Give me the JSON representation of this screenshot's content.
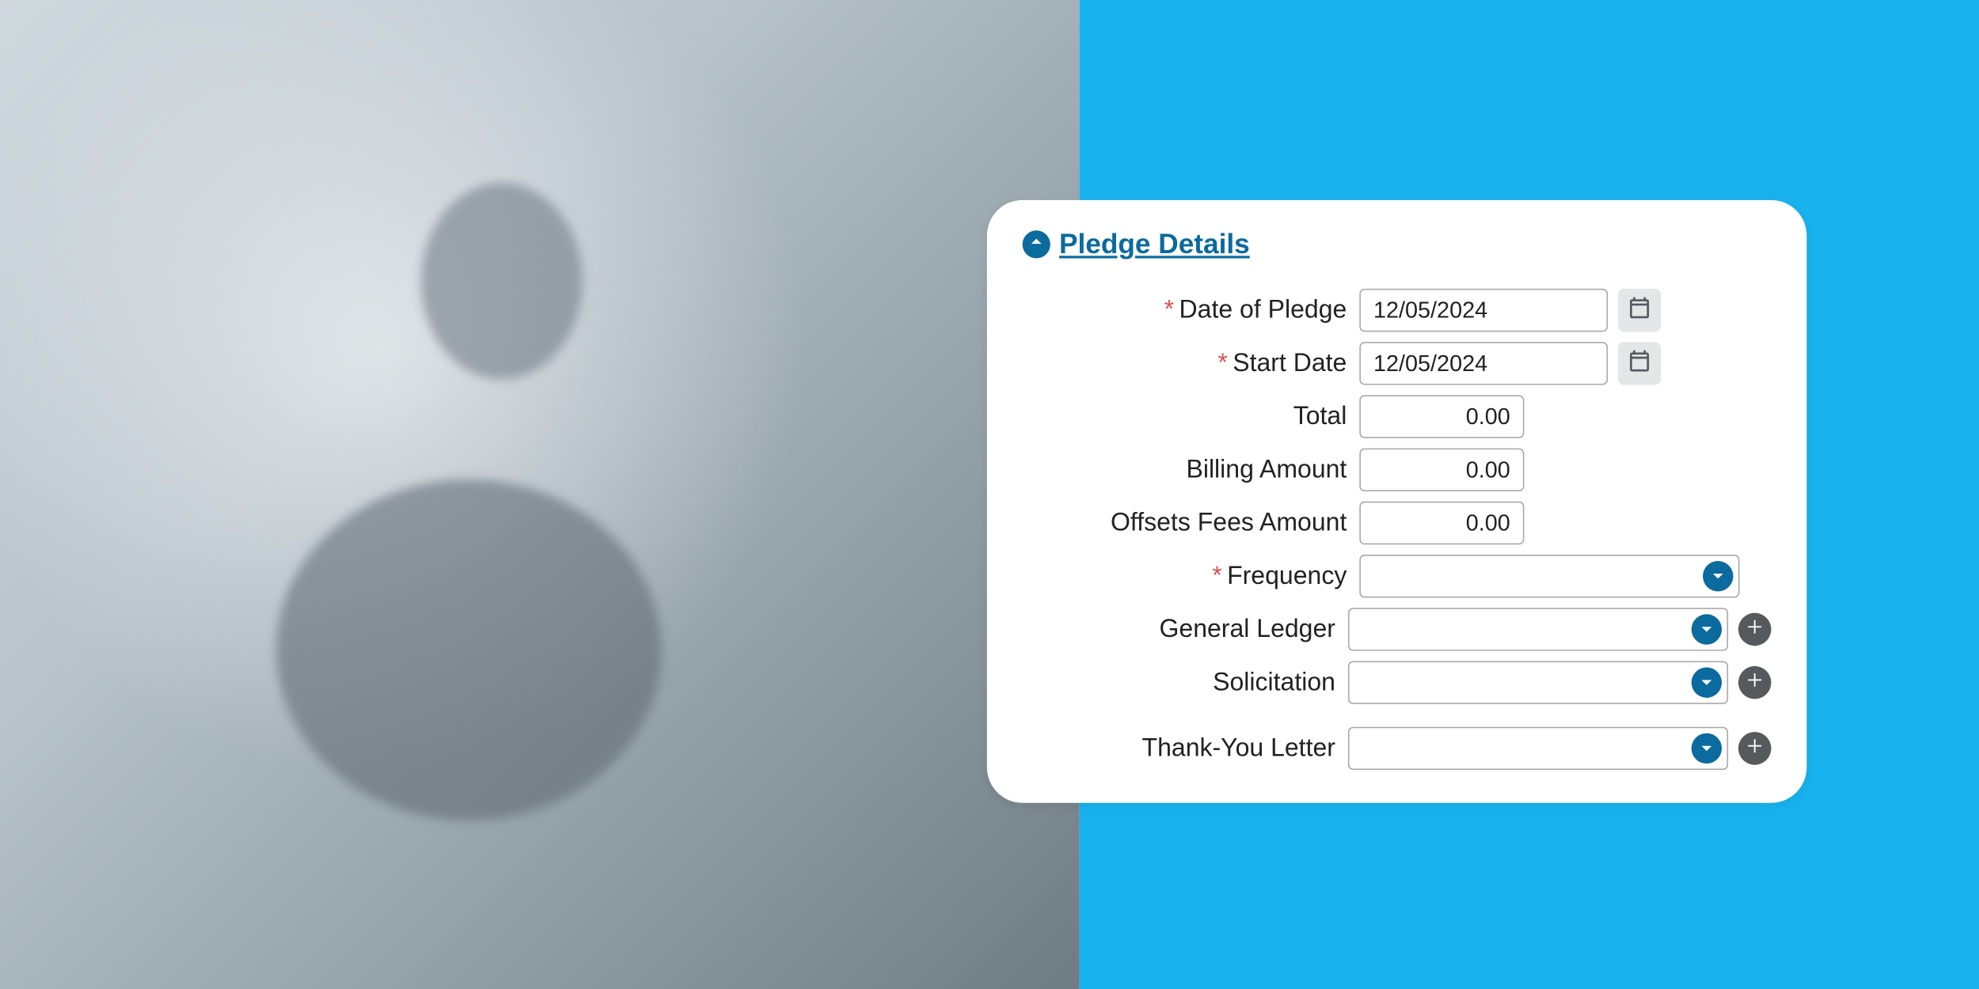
{
  "colors": {
    "accent": "#0b6a9e",
    "blue_bg": "#18b3ee",
    "required": "#d9534f"
  },
  "section": {
    "title": "Pledge Details"
  },
  "fields": {
    "date_of_pledge": {
      "label": "Date of Pledge",
      "value": "12/05/2024",
      "required": true
    },
    "start_date": {
      "label": "Start Date",
      "value": "12/05/2024",
      "required": true
    },
    "total": {
      "label": "Total",
      "value": "0.00"
    },
    "billing_amount": {
      "label": "Billing Amount",
      "value": "0.00"
    },
    "offsets_fees": {
      "label": "Offsets Fees Amount",
      "value": "0.00"
    },
    "frequency": {
      "label": "Frequency",
      "value": "",
      "required": true
    },
    "general_ledger": {
      "label": "General Ledger",
      "value": ""
    },
    "solicitation": {
      "label": "Solicitation",
      "value": ""
    },
    "thank_you": {
      "label": "Thank-You Letter",
      "value": ""
    }
  },
  "icons": {
    "collapse": "chevron-up-icon",
    "calendar": "calendar-icon",
    "chevron_down": "chevron-down-icon",
    "plus": "plus-icon"
  }
}
